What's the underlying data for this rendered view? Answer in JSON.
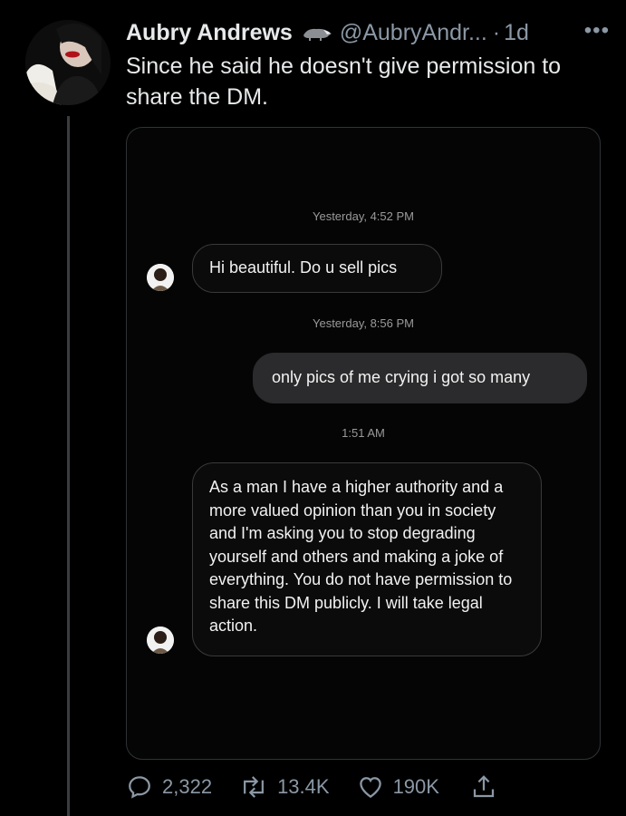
{
  "tweet": {
    "author_name": "Aubry Andrews",
    "handle": "@AubryAndr...",
    "separator": "·",
    "time": "1d",
    "more_label": "•••",
    "text": "Since he said he doesn't give permission to share the DM."
  },
  "dm": {
    "timestamps": [
      "Yesterday, 4:52 PM",
      "Yesterday, 8:56 PM",
      "1:51 AM"
    ],
    "messages": [
      {
        "direction": "incoming",
        "text": "Hi beautiful. Do u sell pics"
      },
      {
        "direction": "outgoing",
        "text": "only pics of me crying i got so many"
      },
      {
        "direction": "incoming",
        "text": "As a man I have a higher authority and a more valued opinion than you in society and I'm asking you to stop degrading yourself and others and making a joke of everything. You do not have permission to share this DM publicly. I will take legal action."
      }
    ]
  },
  "actions": {
    "replies": "2,322",
    "retweets": "13.4K",
    "likes": "190K"
  },
  "icons": [
    "badger-icon",
    "more-icon",
    "reply-icon",
    "retweet-icon",
    "like-icon",
    "share-icon"
  ],
  "colors": {
    "background": "#000000",
    "text": "#e7e9ea",
    "muted": "#8b98a5"
  }
}
